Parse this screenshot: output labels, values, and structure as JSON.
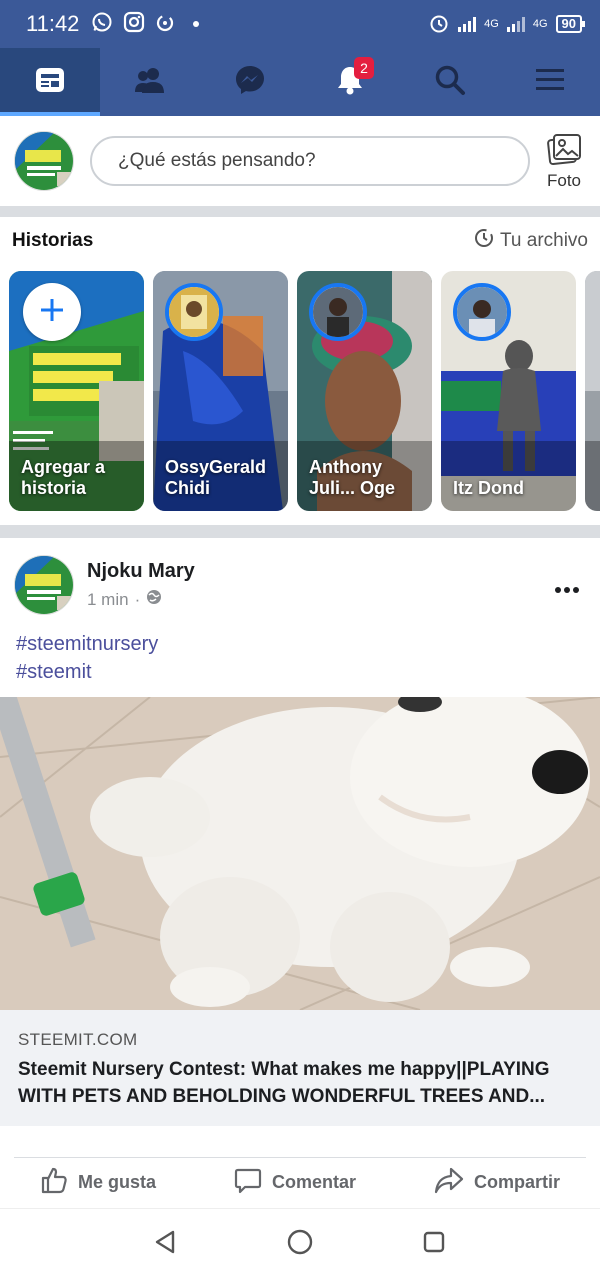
{
  "status_bar": {
    "time": "11:42",
    "network_1": "4G",
    "network_2": "4G",
    "battery": "90"
  },
  "nav": {
    "tabs": [
      {
        "name": "home",
        "icon": "news-feed-icon"
      },
      {
        "name": "friends",
        "icon": "friends-icon"
      },
      {
        "name": "messenger",
        "icon": "messenger-icon"
      },
      {
        "name": "notifications",
        "icon": "bell-icon"
      },
      {
        "name": "search",
        "icon": "search-icon"
      },
      {
        "name": "menu",
        "icon": "menu-icon"
      }
    ],
    "notification_count": "2",
    "active_color": "#29487d",
    "bar_color": "#3b5998"
  },
  "composer": {
    "placeholder": "¿Qué estás pensando?",
    "photo_label": "Foto"
  },
  "stories": {
    "title": "Historias",
    "archive_label": "Tu archivo",
    "items": [
      {
        "name": "Agregar a historia"
      },
      {
        "name": "OssyGerald Chidi"
      },
      {
        "name": "Anthony Juli... Oge"
      },
      {
        "name": "Itz Dond"
      }
    ]
  },
  "post": {
    "author": "Njoku Mary",
    "time": "1 min",
    "separator": "·",
    "hashtags": [
      "#steemitnursery",
      "#steemit"
    ],
    "link": {
      "domain": "STEEMIT.COM",
      "title": "Steemit Nursery Contest: What makes me happy||PLAYING WITH PETS AND BEHOLDING WONDERFUL TREES AND..."
    },
    "actions": {
      "like": "Me gusta",
      "comment": "Comentar",
      "share": "Compartir"
    }
  }
}
